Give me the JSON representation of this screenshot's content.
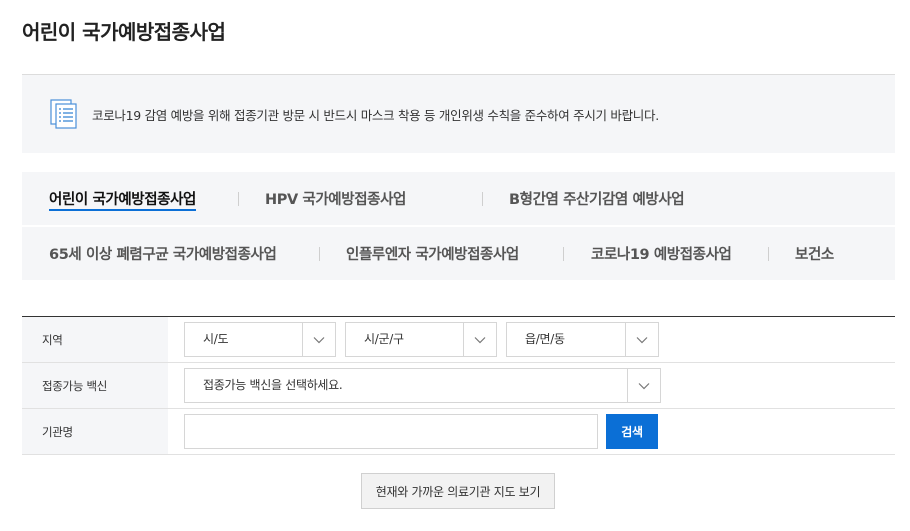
{
  "page": {
    "title": "어린이 국가예방접종사업"
  },
  "notice": {
    "text": "코로나19 감염 예방을 위해 접종기관 방문 시 반드시 마스크 착용 등 개인위생 수칙을 준수하여 주시기 바랍니다.",
    "icon": "document-list-icon"
  },
  "tabs": [
    {
      "label": "어린이 국가예방접종사업",
      "active": true
    },
    {
      "label": "HPV 국가예방접종사업",
      "active": false
    },
    {
      "label": "B형간염 주산기감염 예방사업",
      "active": false
    },
    {
      "label": "65세 이상 폐렴구균 국가예방접종사업",
      "active": false
    },
    {
      "label": "인플루엔자 국가예방접종사업",
      "active": false
    },
    {
      "label": "코로나19 예방접종사업",
      "active": false
    },
    {
      "label": "보건소",
      "active": false
    }
  ],
  "search": {
    "region_label": "지역",
    "sido": "시/도",
    "sigungu": "시/군/구",
    "dong": "읍/면/동",
    "vaccine_label": "접종가능 백신",
    "vaccine_placeholder": "접종가능 백신을 선택하세요.",
    "org_label": "기관명",
    "org_value": "",
    "search_button": "검색"
  },
  "map_button": "현재와 가까운 의료기관 지도 보기",
  "colors": {
    "accent": "#0b6fd6",
    "panel_bg": "#f5f6f8"
  }
}
